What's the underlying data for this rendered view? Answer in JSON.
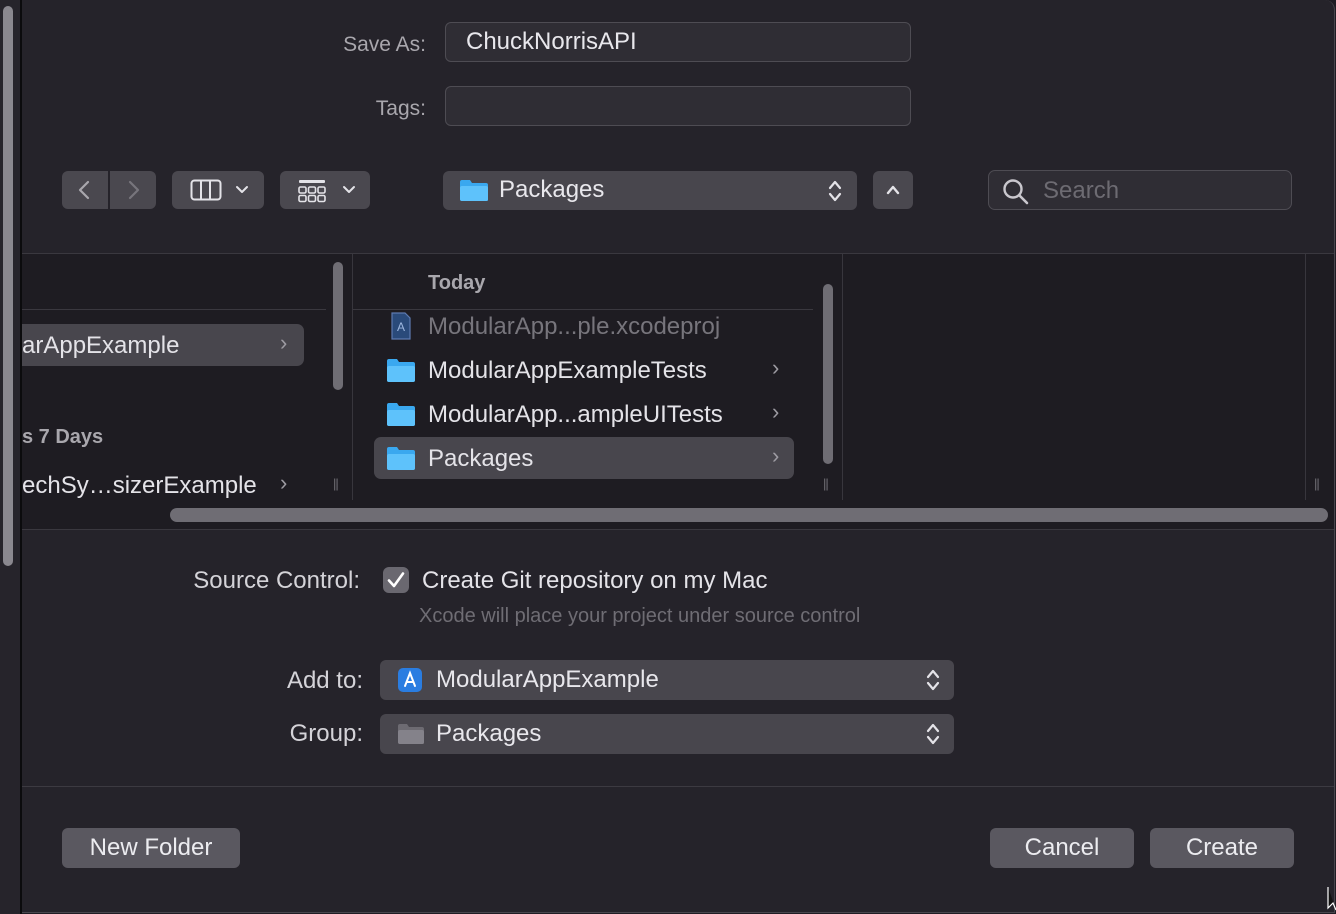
{
  "form": {
    "save_as_label": "Save As:",
    "save_as_value": "ChuckNorrisAPI",
    "tags_label": "Tags:",
    "tags_value": ""
  },
  "toolbar": {
    "back_icon": "chevron-left-icon",
    "forward_icon": "chevron-right-icon",
    "view_mode_icon": "column-view-icon",
    "group_icon": "grid-icon",
    "location": "Packages",
    "search_placeholder": "Search"
  },
  "browser": {
    "left_column": {
      "items": [
        {
          "label": "arAppExample",
          "selected": true,
          "has_children": true
        }
      ],
      "section": "s 7 Days",
      "section_items": [
        {
          "label": "echSy…sizerExample",
          "has_children": true
        }
      ]
    },
    "middle_column": {
      "section": "Today",
      "items": [
        {
          "label": "ModularApp...ple.xcodeproj",
          "icon": "xcodeproj-icon",
          "disabled": true,
          "has_children": false
        },
        {
          "label": "ModularAppExampleTests",
          "icon": "folder-icon",
          "has_children": true
        },
        {
          "label": "ModularApp...ampleUITests",
          "icon": "folder-icon",
          "has_children": true
        },
        {
          "label": "Packages",
          "icon": "folder-icon",
          "selected": true,
          "has_children": true
        }
      ]
    }
  },
  "options": {
    "source_control_label": "Source Control:",
    "git_checkbox_label": "Create Git repository on my Mac",
    "git_checked": true,
    "git_hint": "Xcode will place your project under source control",
    "add_to_label": "Add to:",
    "add_to_value": "ModularAppExample",
    "group_label": "Group:",
    "group_value": "Packages"
  },
  "buttons": {
    "new_folder": "New Folder",
    "cancel": "Cancel",
    "create": "Create"
  },
  "colors": {
    "panel": "#25232a",
    "folder_blue": "#3aa8ef",
    "accent_blue": "#2a7de1"
  }
}
